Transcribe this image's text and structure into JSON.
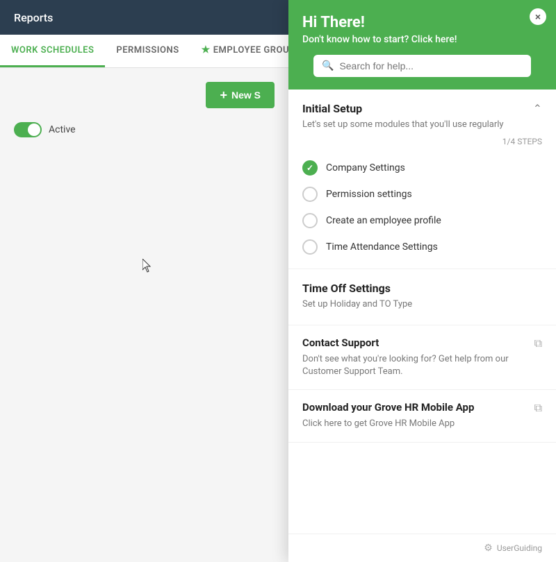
{
  "app": {
    "title": "Reports"
  },
  "tabs": [
    {
      "label": "WORK SCHEDULES",
      "active": true,
      "star": false
    },
    {
      "label": "PERMISSIONS",
      "active": false,
      "star": false
    },
    {
      "label": "EMPLOYEE GROUPS",
      "active": false,
      "star": true
    }
  ],
  "main": {
    "new_button_label": "+ New S...",
    "new_button_plus": "+",
    "new_button_text": "New S",
    "toggle_label": "Active"
  },
  "help": {
    "close_label": "×",
    "greeting": "Hi There!",
    "subtitle": "Don't know how to start? Click here!",
    "search_placeholder": "Search for help...",
    "initial_setup": {
      "title": "Initial Setup",
      "description": "Let's set up some modules that you'll use regularly",
      "steps_progress": "1/4 STEPS",
      "steps": [
        {
          "label": "Company Settings",
          "completed": true
        },
        {
          "label": "Permission settings",
          "completed": false
        },
        {
          "label": "Create an employee profile",
          "completed": false
        },
        {
          "label": "Time Attendance Settings",
          "completed": false
        }
      ]
    },
    "time_off": {
      "title": "Time Off Settings",
      "description": "Set up Holiday and TO Type"
    },
    "contact_support": {
      "title": "Contact Support",
      "description": "Don't see what you're looking for? Get help from our Customer Support Team.",
      "external": true
    },
    "mobile_app": {
      "title": "Download your Grove HR Mobile App",
      "description": "Click here to get Grove HR Mobile App",
      "external": true
    }
  },
  "footer": {
    "userguiding_label": "UserGuiding"
  }
}
